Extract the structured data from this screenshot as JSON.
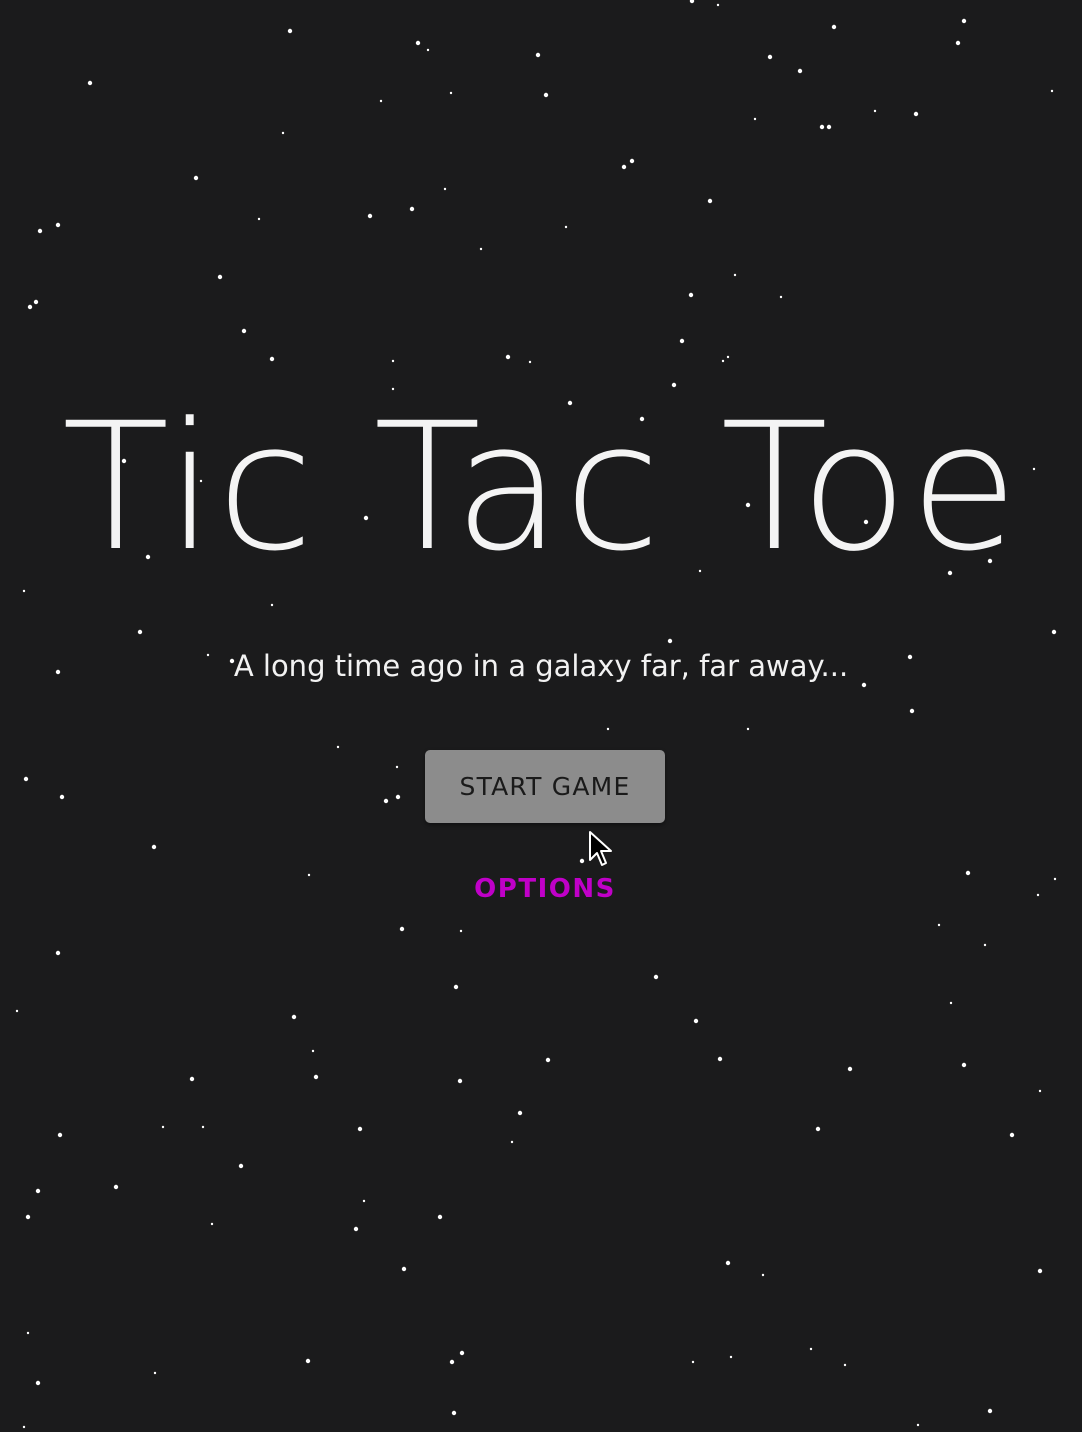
{
  "game": {
    "title": "Tic Tac Toe",
    "subtitle": "A long time ago in a galaxy far, far away..."
  },
  "menu": {
    "start_label": "START GAME",
    "options_label": "OPTIONS"
  },
  "colors": {
    "background": "#1b1b1c",
    "star": "#ffffff",
    "title_text": "#f4f4f4",
    "start_button_bg": "#8c8c8c",
    "start_button_text": "#1a1a1a",
    "options_text": "#c000c8"
  },
  "icons": {
    "pointer": "mouse-pointer-icon"
  }
}
